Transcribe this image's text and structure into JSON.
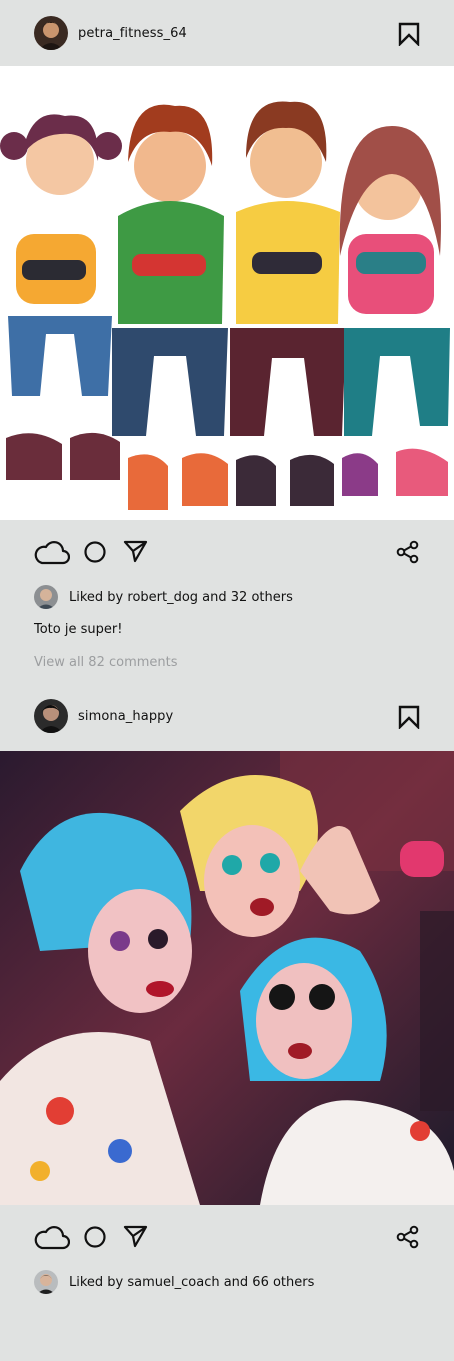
{
  "posts": [
    {
      "username": "petra_fitness_64",
      "liked_by": "Liked by robert_dog and 32 others",
      "caption": "Toto je super!",
      "view_comments": "View all 82 comments",
      "avatar_icon": "user-avatar",
      "image_desc": "cartoon-kids-gaming"
    },
    {
      "username": "simona_happy",
      "liked_by": "Liked by samuel_coach and 66 others",
      "avatar_icon": "user-avatar",
      "image_desc": "colorful-party-photo"
    }
  ],
  "icons": {
    "like": "cloud-icon",
    "comment": "circle-icon",
    "send": "paper-plane-icon",
    "share": "share-icon",
    "save": "bookmark-icon"
  },
  "colors": {
    "background": "#e0e2e1",
    "muted_text": "#9c9ea0"
  }
}
